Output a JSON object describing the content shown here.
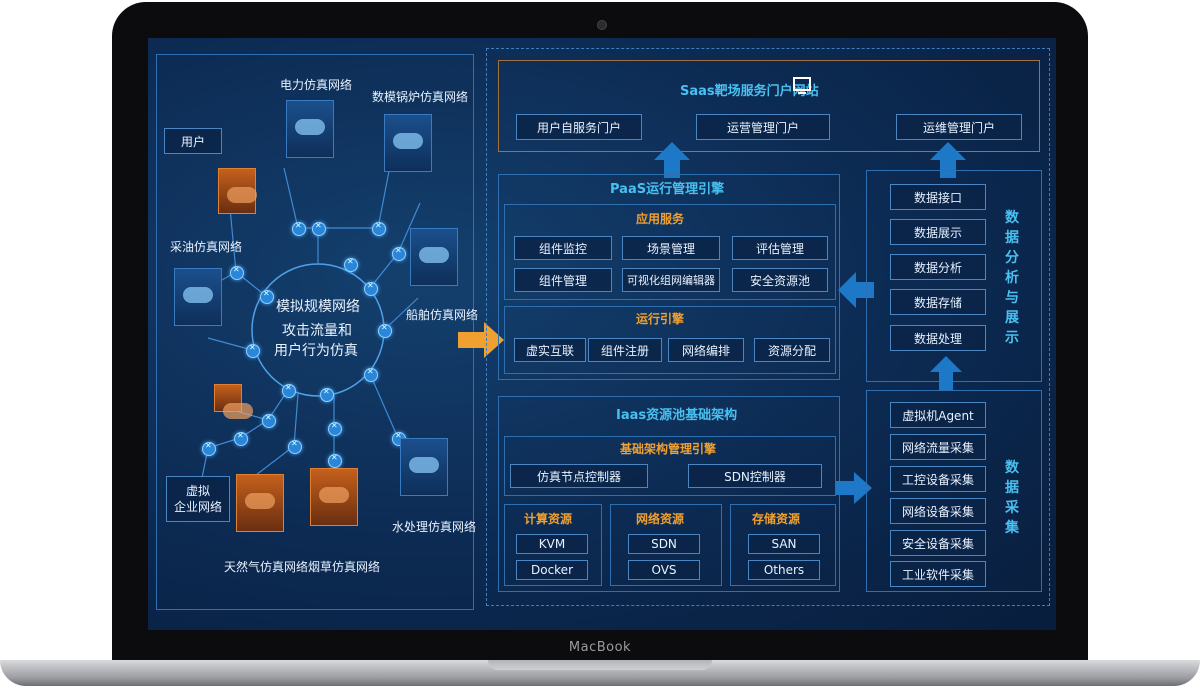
{
  "device": {
    "brand": "MacBook"
  },
  "left_panel": {
    "center_title": "模拟规模网络",
    "center_line1": "攻击流量和",
    "center_line2": "用户行为仿真",
    "networks": {
      "power": "电力仿真网络",
      "boiler": "数模锅炉仿真网络",
      "user": "用户",
      "oil": "采油仿真网络",
      "ship": "船舶仿真网络",
      "virtual_line1": "虚拟",
      "virtual_line2": "企业网络",
      "gas": "天然气仿真网络",
      "tobacco": "烟草仿真网络",
      "water": "水处理仿真网络"
    }
  },
  "saas": {
    "title": "Saas靶场服务门户网站",
    "buttons": [
      "用户自服务门户",
      "运营管理门户",
      "运维管理门户"
    ]
  },
  "paas": {
    "title": "PaaS运行管理引擎",
    "app_service": {
      "title": "应用服务",
      "items": [
        "组件监控",
        "场景管理",
        "评估管理",
        "组件管理",
        "可视化组网编辑器",
        "安全资源池"
      ]
    },
    "engine": {
      "title": "运行引擎",
      "items": [
        "虚实互联",
        "组件注册",
        "网络编排",
        "资源分配"
      ]
    }
  },
  "iaas": {
    "title": "Iaas资源池基础架构",
    "infra_engine": {
      "title": "基础架构管理引擎",
      "items": [
        "仿真节点控制器",
        "SDN控制器"
      ]
    },
    "compute": {
      "title": "计算资源",
      "items": [
        "KVM",
        "Docker"
      ]
    },
    "network": {
      "title": "网络资源",
      "items": [
        "SDN",
        "OVS"
      ]
    },
    "storage": {
      "title": "存储资源",
      "items": [
        "SAN",
        "Others"
      ]
    }
  },
  "data_analysis": {
    "title": "数据分析与展示",
    "items": [
      "数据接口",
      "数据展示",
      "数据分析",
      "数据存储",
      "数据处理"
    ]
  },
  "data_collect": {
    "title": "数据采集",
    "items": [
      "虚拟机Agent",
      "网络流量采集",
      "工控设备采集",
      "网络设备采集",
      "安全设备采集",
      "工业软件采集"
    ]
  },
  "colors": {
    "accent_cyan": "#48c0f0",
    "accent_orange": "#f0a030",
    "arrow_blue": "#1e78c8"
  }
}
